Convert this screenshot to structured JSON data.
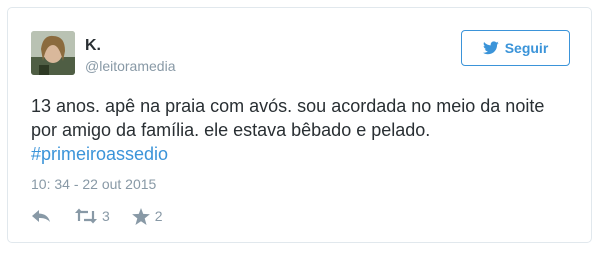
{
  "user": {
    "name": "K.",
    "handle": "@leitoramedia"
  },
  "follow_button": {
    "label": "Seguir",
    "icon": "twitter-bird-icon"
  },
  "tweet": {
    "lines": [
      "13 anos. apê na praia com avós. sou acordada no meio da noite",
      "por amigo da família. ele estava bêbado e pelado."
    ],
    "hashtag": "#primeiroassedio",
    "timestamp": "10: 34 - 22 out 2015"
  },
  "actions": {
    "reply_icon": "reply-icon",
    "retweet_icon": "retweet-icon",
    "retweet_count": "3",
    "favorite_icon": "star-icon",
    "favorite_count": "2"
  },
  "colors": {
    "accent": "#3b94d9",
    "text": "#292f33",
    "muted": "#8899a6",
    "border": "#e1e8ed"
  }
}
